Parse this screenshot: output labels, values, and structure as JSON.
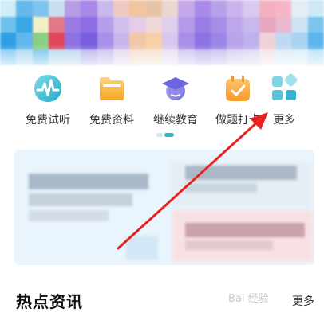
{
  "banner": {
    "colors": [
      "#d0ecf8",
      "#67b8e8",
      "#7ec3f0",
      "#c8dff2",
      "#b79ce6",
      "#a889e8",
      "#c9b9ee",
      "#f0c9c0",
      "#f3c4a0",
      "#e7c4a8",
      "#ead7d0",
      "#c5a8ea",
      "#a98ae6",
      "#b7a2ea",
      "#cdb3ec",
      "#d7c9f0",
      "#f3b1c0",
      "#f5b7c8",
      "#e3edf6",
      "#cfe8f6",
      "#6fc2ee",
      "#3ba6e6",
      "#f0f0c8",
      "#e07a8a",
      "#9c7ae2",
      "#8e6ee4",
      "#b69ee8",
      "#d2c0ee",
      "#e6cce8",
      "#f0d8d8",
      "#e0d0ee",
      "#b49ae8",
      "#9a7ce6",
      "#a58ee8",
      "#bda6ea",
      "#c8b8ee",
      "#e6a8c0",
      "#eab8d0",
      "#cde3f4",
      "#7cc4ee",
      "#2f9fe4",
      "#62b7ea",
      "#8bcf84",
      "#e2465a",
      "#8d72e0",
      "#7a5ee0",
      "#a690e8",
      "#cbb6ec",
      "#f0c8a8",
      "#f6d0a8",
      "#d8c8ee",
      "#a890e8",
      "#8e72e4",
      "#9a86e6",
      "#b8a4ea",
      "#bfb0ee",
      "#f1d0d8",
      "#c0d8f4",
      "#a8d4f2",
      "#5cb6ec",
      "#7cc6ee",
      "#a9d6f2",
      "#70c0e8",
      "#b0d8f0",
      "#b6d4ee",
      "#b8b0ea",
      "#c6c0ee",
      "#e2d6ee",
      "#f2dccc",
      "#f4e0cc",
      "#e8dff2",
      "#cbc2ee",
      "#bcb4ec",
      "#c4bcee",
      "#d6ccf0",
      "#dcd4f2",
      "#f2e2e8",
      "#dceaf6",
      "#d8ecf8",
      "#b8e0f6"
    ]
  },
  "quick_nav": [
    {
      "label": "免费试听",
      "icon": "audio-wave-icon"
    },
    {
      "label": "免费资料",
      "icon": "folder-icon"
    },
    {
      "label": "继续教育",
      "icon": "graduation-cap-icon"
    },
    {
      "label": "做题打卡",
      "icon": "calendar-check-icon"
    },
    {
      "label": "更多",
      "icon": "grid-more-icon"
    }
  ],
  "pager": {
    "pages": 2,
    "active": 2
  },
  "section": {
    "title": "热点资讯",
    "more_label": "更多"
  },
  "watermark": "Bai 经验",
  "colors": {
    "accent": "#2bb8c8",
    "annotation_arrow": "#e8231f",
    "text_primary": "#333333"
  }
}
